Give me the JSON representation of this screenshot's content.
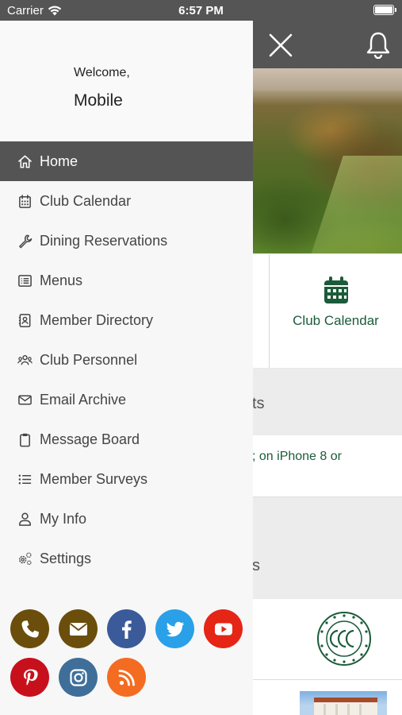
{
  "status_bar": {
    "carrier": "Carrier",
    "time": "6:57 PM"
  },
  "drawer": {
    "welcome_text": "Welcome,",
    "user_name": "Mobile",
    "menu": [
      {
        "label": "Home",
        "icon": "home-icon",
        "active": true
      },
      {
        "label": "Club Calendar",
        "icon": "calendar-icon",
        "active": false
      },
      {
        "label": "Dining Reservations",
        "icon": "wrench-icon",
        "active": false
      },
      {
        "label": "Menus",
        "icon": "list-box-icon",
        "active": false
      },
      {
        "label": "Member Directory",
        "icon": "contact-book-icon",
        "active": false
      },
      {
        "label": "Club Personnel",
        "icon": "people-icon",
        "active": false
      },
      {
        "label": "Email Archive",
        "icon": "envelope-icon",
        "active": false
      },
      {
        "label": "Message Board",
        "icon": "clipboard-icon",
        "active": false
      },
      {
        "label": "Member Surveys",
        "icon": "bulleted-list-icon",
        "active": false
      },
      {
        "label": "My Info",
        "icon": "user-icon",
        "active": false
      },
      {
        "label": "Settings",
        "icon": "gears-icon",
        "active": false
      }
    ],
    "social": [
      {
        "name": "phone",
        "icon": "phone-icon",
        "color": "#6b4e0b"
      },
      {
        "name": "email",
        "icon": "envelope-icon",
        "color": "#6b4e0b"
      },
      {
        "name": "facebook",
        "icon": "facebook-icon",
        "color": "#3b5a9a"
      },
      {
        "name": "twitter",
        "icon": "twitter-icon",
        "color": "#29a0e8"
      },
      {
        "name": "youtube",
        "icon": "youtube-icon",
        "color": "#e52516"
      },
      {
        "name": "pinterest",
        "icon": "pinterest-icon",
        "color": "#c8101c"
      },
      {
        "name": "instagram",
        "icon": "instagram-icon",
        "color": "#3f6f99"
      },
      {
        "name": "rss",
        "icon": "rss-icon",
        "color": "#f36c21"
      }
    ]
  },
  "background": {
    "calendar_tile_label": "Club Calendar",
    "section1_fragment": "ts",
    "news_fragment": "; on iPhone 8 or",
    "section2_fragment": "s",
    "accent_color": "#1b5b3a",
    "header_color": "#555555"
  }
}
